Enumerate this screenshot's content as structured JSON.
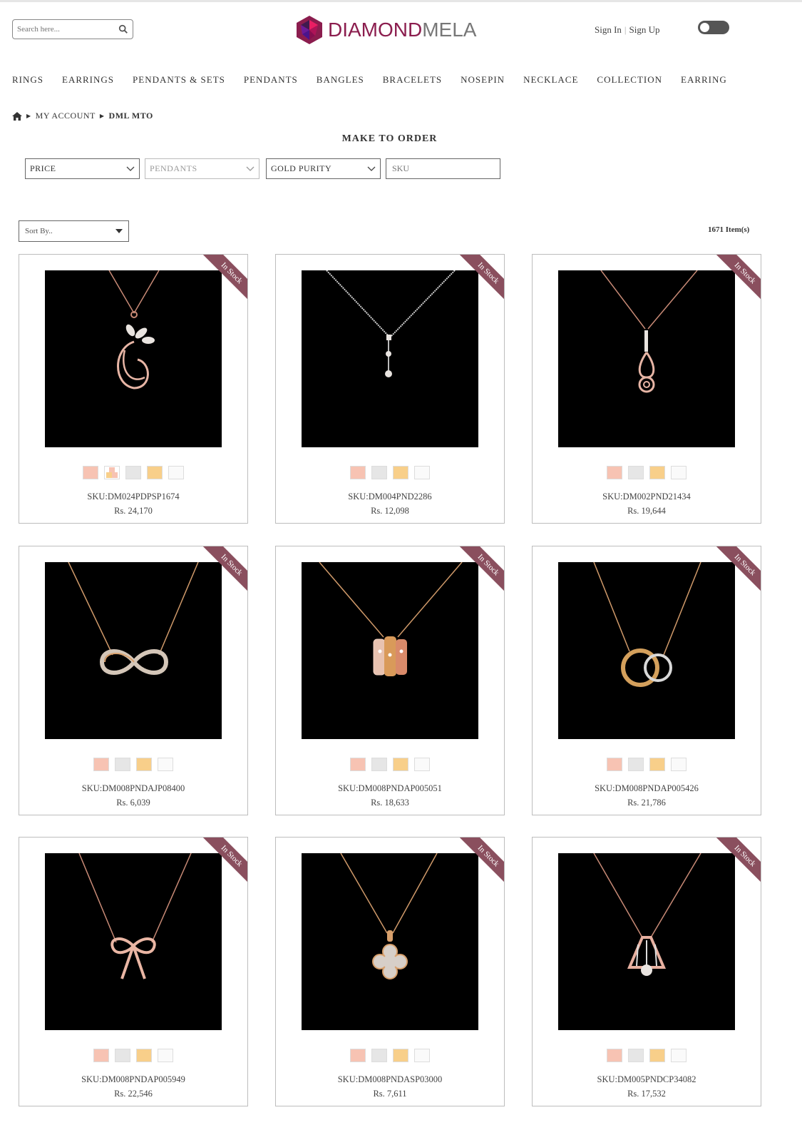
{
  "header": {
    "search_placeholder": "Search here...",
    "brand_part1": "DIAMOND",
    "brand_part2": "MELA",
    "sign_in": "Sign In",
    "sign_up": "Sign Up"
  },
  "nav": [
    "RINGS",
    "EARRINGS",
    "PENDANTS & SETS",
    "PENDANTS",
    "BANGLES",
    "BRACELETS",
    "NOSEPIN",
    "NECKLACE",
    "COLLECTION",
    "EARRING"
  ],
  "breadcrumb": [
    "MY ACCOUNT",
    "DML MTO"
  ],
  "page_title": "MAKE TO ORDER",
  "filters": {
    "price": "PRICE",
    "category": "PENDANTS",
    "gold_purity": "GOLD PURITY",
    "sku_placeholder": "SKU"
  },
  "sort_label": "Sort By..",
  "item_count": "1671 Item(s)",
  "badge": "In Stock",
  "colors": {
    "brand": "#8b1d4e",
    "ribbon": "#8a4f5e",
    "rose_gold": "#f7c3b3",
    "white_gold": "#e6e6e6",
    "yellow_gold": "#f8cf8a"
  },
  "products": [
    {
      "sku": "SKU:DM024PDPSP1674",
      "price": "Rs. 24,170",
      "swatches": [
        "rose",
        "multi",
        "white",
        "yellow",
        "plat"
      ],
      "pendant": "flower-swirl"
    },
    {
      "sku": "SKU:DM004PND2286",
      "price": "Rs. 12,098",
      "swatches": [
        "rose",
        "white",
        "yellow",
        "plat"
      ],
      "pendant": "drop-trio"
    },
    {
      "sku": "SKU:DM002PND21434",
      "price": "Rs. 19,644",
      "swatches": [
        "rose",
        "white",
        "yellow",
        "plat"
      ],
      "pendant": "rose-drop"
    },
    {
      "sku": "SKU:DM008PNDAJP08400",
      "price": "Rs. 6,039",
      "swatches": [
        "rose",
        "white",
        "yellow",
        "plat"
      ],
      "pendant": "infinity"
    },
    {
      "sku": "SKU:DM008PNDAP005051",
      "price": "Rs. 18,633",
      "swatches": [
        "rose",
        "white",
        "yellow",
        "plat"
      ],
      "pendant": "rings-trio"
    },
    {
      "sku": "SKU:DM008PNDAP005426",
      "price": "Rs. 21,786",
      "swatches": [
        "rose",
        "white",
        "yellow",
        "plat"
      ],
      "pendant": "double-circle"
    },
    {
      "sku": "SKU:DM008PNDAP005949",
      "price": "Rs. 22,546",
      "swatches": [
        "rose",
        "white",
        "yellow",
        "plat"
      ],
      "pendant": "bow"
    },
    {
      "sku": "SKU:DM008PNDASP03000",
      "price": "Rs. 7,611",
      "swatches": [
        "rose",
        "white",
        "yellow",
        "plat"
      ],
      "pendant": "clover"
    },
    {
      "sku": "SKU:DM005PNDCP34082",
      "price": "Rs. 17,532",
      "swatches": [
        "rose",
        "white",
        "yellow",
        "plat"
      ],
      "pendant": "bell-flower"
    }
  ]
}
